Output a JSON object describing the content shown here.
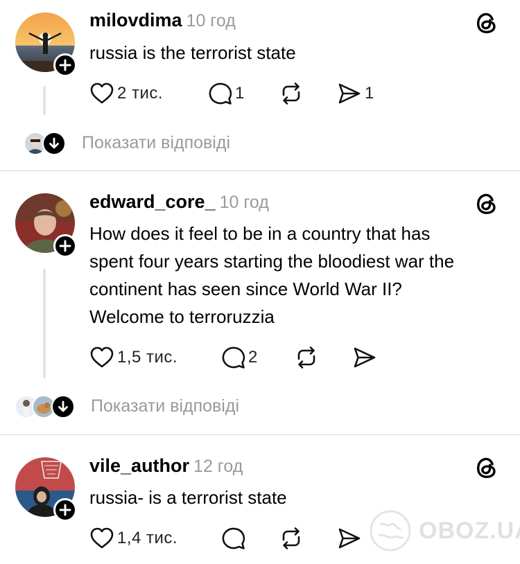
{
  "posts": [
    {
      "username": "milovdima",
      "time": "10 год",
      "text": "russia is the terrorist state",
      "likes": "2 тис.",
      "comments": "1",
      "reposts": "",
      "shares": "1",
      "show_replies": "Показати відповіді"
    },
    {
      "username": "edward_core_",
      "time": "10 год",
      "text_lines": [
        "How does it feel to be in a country that has",
        "spent four years starting the bloodiest war the",
        "continent has seen since World War II?",
        "Welcome to terroruzzia"
      ],
      "likes": "1,5 тис.",
      "comments": "2",
      "reposts": "",
      "shares": "",
      "show_replies": "Показати відповіді"
    },
    {
      "username": "vile_author",
      "time": "12 год",
      "text": "russia- is a terrorist state",
      "likes": "1,4 тис.",
      "comments": "",
      "reposts": "",
      "shares": ""
    }
  ],
  "watermark": {
    "text": "OBOZ.UA"
  },
  "icons": {
    "follow": "plus-icon",
    "like": "heart-icon",
    "comment": "comment-icon",
    "repost": "repost-icon",
    "share": "send-icon",
    "logo": "threads-logo-icon",
    "expand": "arrow-down-icon"
  }
}
